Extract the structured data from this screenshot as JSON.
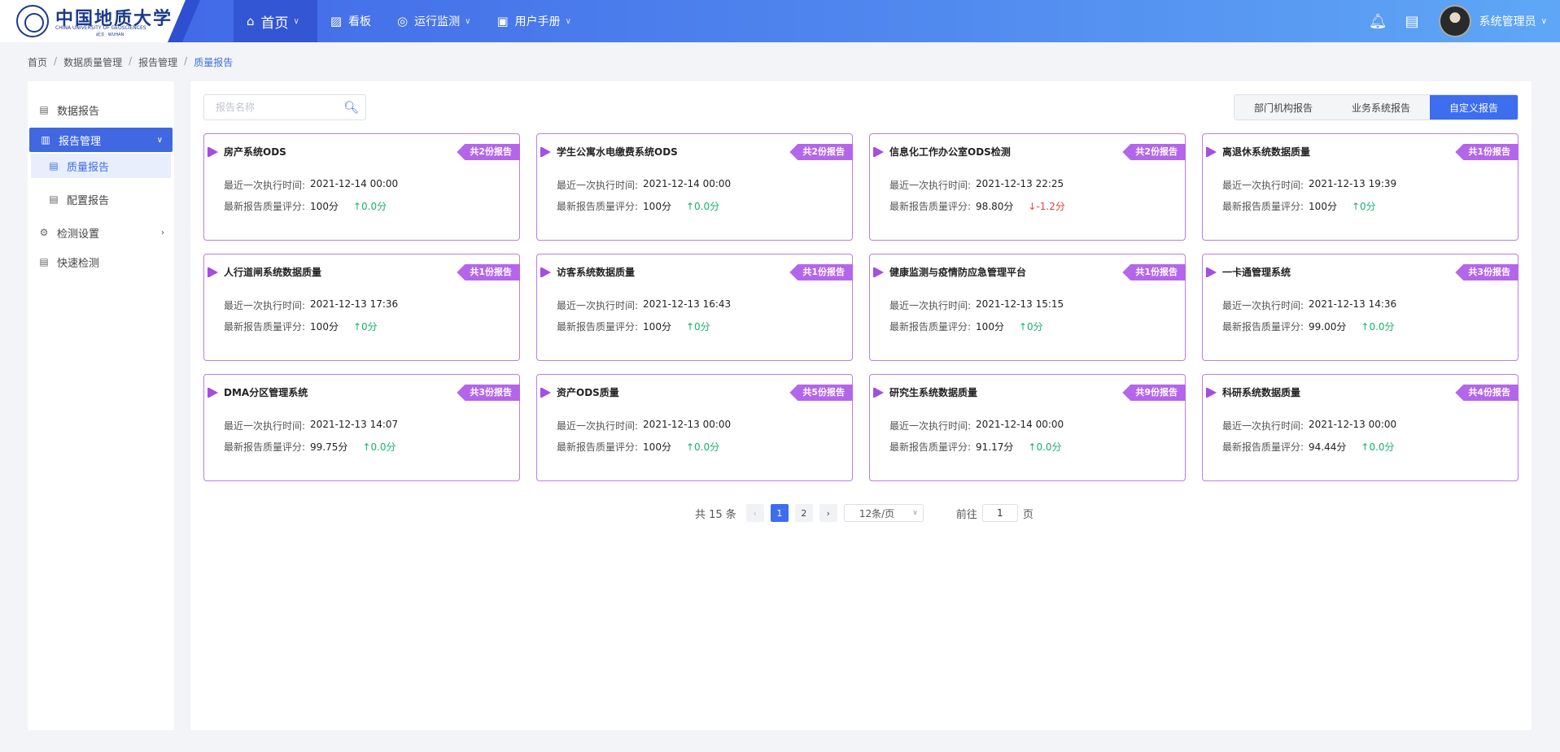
{
  "header": {
    "logo": {
      "cn": "中国地质大学",
      "en": "CHINA UNIVERSITY OF GEOSCIENCES",
      "sub": "武汉 · WUHAN"
    },
    "nav": [
      {
        "label": "首页",
        "icon": "home-icon",
        "dropdown": true,
        "active": true
      },
      {
        "label": "看板",
        "icon": "chart-icon",
        "dropdown": false
      },
      {
        "label": "运行监测",
        "icon": "monitor-icon",
        "dropdown": true
      },
      {
        "label": "用户手册",
        "icon": "book-icon",
        "dropdown": true
      }
    ],
    "user": {
      "name": "系统管理员"
    }
  },
  "breadcrumb": [
    "首页",
    "数据质量管理",
    "报告管理",
    "质量报告"
  ],
  "sidebar": {
    "items": [
      {
        "label": "数据报告",
        "icon": "document-icon"
      },
      {
        "label": "报告管理",
        "icon": "clipboard-icon",
        "expanded": true
      },
      {
        "label": "质量报告",
        "icon": "document-icon",
        "child": true,
        "active": true
      },
      {
        "label": "配置报告",
        "icon": "document-icon",
        "child": true
      },
      {
        "label": "检测设置",
        "icon": "gear-icon",
        "arrow": true
      },
      {
        "label": "快速检测",
        "icon": "document-icon"
      }
    ]
  },
  "search": {
    "placeholder": "报告名称"
  },
  "tabs": [
    {
      "label": "部门机构报告",
      "active": false
    },
    {
      "label": "业务系统报告",
      "active": false
    },
    {
      "label": "自定义报告",
      "active": true
    }
  ],
  "labels": {
    "exec_time": "最近一次执行时间:",
    "score": "最新报告质量评分:"
  },
  "cards": [
    {
      "title": "房产系统ODS",
      "badge": "共2份报告",
      "time": "2021-12-14 00:00",
      "score": "100分",
      "change": "0.0分",
      "trend": "up"
    },
    {
      "title": "学生公寓水电缴费系统ODS",
      "badge": "共2份报告",
      "time": "2021-12-14 00:00",
      "score": "100分",
      "change": "0.0分",
      "trend": "up"
    },
    {
      "title": "信息化工作办公室ODS检测",
      "badge": "共2份报告",
      "time": "2021-12-13 22:25",
      "score": "98.80分",
      "change": "-1.2分",
      "trend": "down"
    },
    {
      "title": "离退休系统数据质量",
      "badge": "共1份报告",
      "time": "2021-12-13 19:39",
      "score": "100分",
      "change": "0分",
      "trend": "up"
    },
    {
      "title": "人行道闸系统数据质量",
      "badge": "共1份报告",
      "time": "2021-12-13 17:36",
      "score": "100分",
      "change": "0分",
      "trend": "up"
    },
    {
      "title": "访客系统数据质量",
      "badge": "共1份报告",
      "time": "2021-12-13 16:43",
      "score": "100分",
      "change": "0分",
      "trend": "up"
    },
    {
      "title": "健康监测与疫情防应急管理平台",
      "badge": "共1份报告",
      "time": "2021-12-13 15:15",
      "score": "100分",
      "change": "0分",
      "trend": "up"
    },
    {
      "title": "一卡通管理系统",
      "badge": "共3份报告",
      "time": "2021-12-13 14:36",
      "score": "99.00分",
      "change": "0.0分",
      "trend": "up"
    },
    {
      "title": "DMA分区管理系统",
      "badge": "共3份报告",
      "time": "2021-12-13 14:07",
      "score": "99.75分",
      "change": "0.0分",
      "trend": "up"
    },
    {
      "title": "资产ODS质量",
      "badge": "共5份报告",
      "time": "2021-12-13 00:00",
      "score": "100分",
      "change": "0.0分",
      "trend": "up"
    },
    {
      "title": "研究生系统数据质量",
      "badge": "共9份报告",
      "time": "2021-12-14 00:00",
      "score": "91.17分",
      "change": "0.0分",
      "trend": "up"
    },
    {
      "title": "科研系统数据质量",
      "badge": "共4份报告",
      "time": "2021-12-13 00:00",
      "score": "94.44分",
      "change": "0.0分",
      "trend": "up"
    }
  ],
  "pagination": {
    "total": "共 15 条",
    "pages": [
      "1",
      "2"
    ],
    "current": "1",
    "page_size": "12条/页",
    "goto_prefix": "前往",
    "goto_value": "1",
    "goto_suffix": "页"
  },
  "colors": {
    "primary": "#3d6ef0",
    "card_border": "#b87fe3",
    "badge": "#b466ea",
    "up": "#18b26a",
    "down": "#e8423a"
  }
}
